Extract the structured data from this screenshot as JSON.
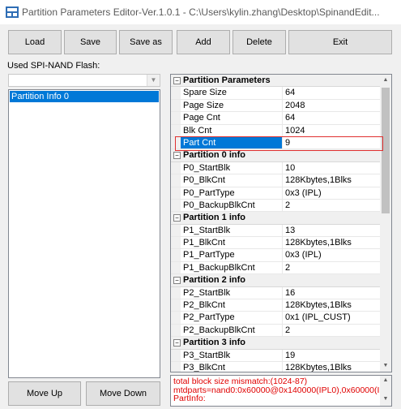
{
  "window": {
    "title": "Partition Parameters Editor-Ver.1.0.1 - C:\\Users\\kylin.zhang\\Desktop\\SpinandEdit..."
  },
  "toolbar": {
    "load": "Load",
    "save": "Save",
    "save_as": "Save as",
    "add": "Add",
    "delete": "Delete",
    "exit": "Exit"
  },
  "flash": {
    "label": "Used SPI-NAND Flash:",
    "selected": "",
    "list": [
      "Partition Info 0"
    ]
  },
  "grid": {
    "categories": [
      {
        "name": "Partition Parameters",
        "rows": [
          {
            "name": "Spare Size",
            "value": "64"
          },
          {
            "name": "Page Size",
            "value": "2048"
          },
          {
            "name": "Page Cnt",
            "value": "64"
          },
          {
            "name": "Blk Cnt",
            "value": "1024"
          },
          {
            "name": "Part Cnt",
            "value": "9",
            "selected": true
          }
        ]
      },
      {
        "name": "Partition 0 info",
        "rows": [
          {
            "name": "P0_StartBlk",
            "value": "10"
          },
          {
            "name": "P0_BlkCnt",
            "value": "128Kbytes,1Blks"
          },
          {
            "name": "P0_PartType",
            "value": "0x3 (IPL)"
          },
          {
            "name": "P0_BackupBlkCnt",
            "value": "2"
          }
        ]
      },
      {
        "name": "Partition 1 info",
        "rows": [
          {
            "name": "P1_StartBlk",
            "value": "13"
          },
          {
            "name": "P1_BlkCnt",
            "value": "128Kbytes,1Blks"
          },
          {
            "name": "P1_PartType",
            "value": "0x3 (IPL)"
          },
          {
            "name": "P1_BackupBlkCnt",
            "value": "2"
          }
        ]
      },
      {
        "name": "Partition 2 info",
        "rows": [
          {
            "name": "P2_StartBlk",
            "value": "16"
          },
          {
            "name": "P2_BlkCnt",
            "value": "128Kbytes,1Blks"
          },
          {
            "name": "P2_PartType",
            "value": "0x1 (IPL_CUST)"
          },
          {
            "name": "P2_BackupBlkCnt",
            "value": "2"
          }
        ]
      },
      {
        "name": "Partition 3 info",
        "rows": [
          {
            "name": "P3_StartBlk",
            "value": "19"
          },
          {
            "name": "P3_BlkCnt",
            "value": "128Kbytes,1Blks"
          }
        ]
      }
    ]
  },
  "buttons": {
    "move_up": "Move Up",
    "move_down": "Move Down"
  },
  "messages": [
    "total block size mismatch:(1024-87)",
    "mtdparts=nand0:0x60000@0x140000(IPL0),0x60000(IPL",
    "PartInfo:"
  ],
  "colors": {
    "selection": "#0078d7",
    "error_text": "#e00000",
    "highlight_border": "#e03030"
  }
}
